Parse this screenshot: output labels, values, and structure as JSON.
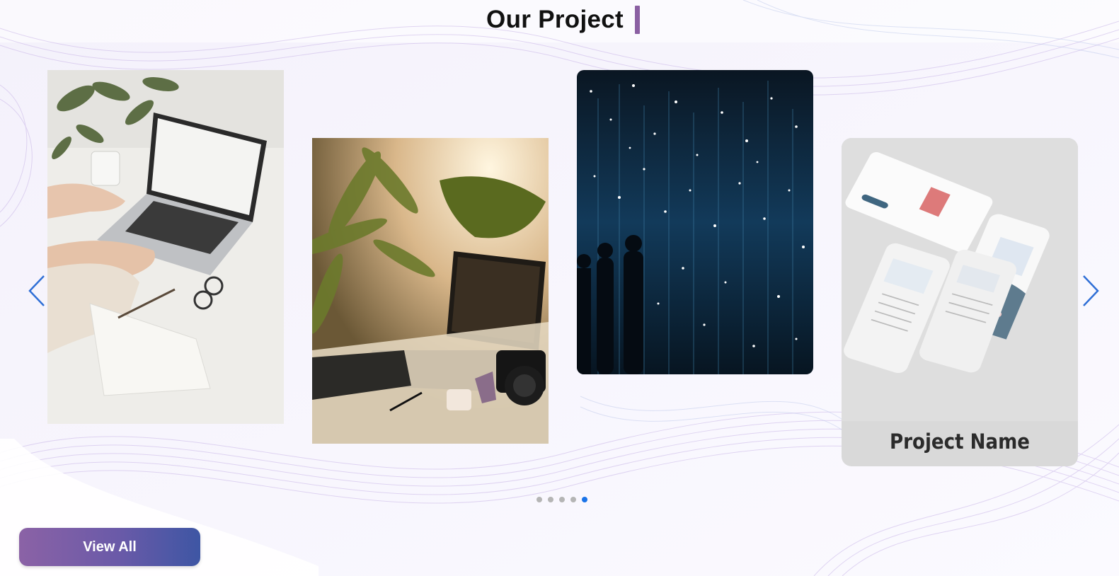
{
  "header": {
    "title": "Our Project",
    "accent_color": "#8a5fa2"
  },
  "carousel": {
    "cards": [
      {
        "id": "card1",
        "image": "laptop-desk-photo"
      },
      {
        "id": "card2",
        "image": "laptop-plants-photo"
      },
      {
        "id": "card3",
        "image": "light-installation-photo"
      },
      {
        "id": "card4",
        "image": "mobile-app-mockup",
        "project_name": "Project Name"
      }
    ],
    "prev_icon": "chevron-left-icon",
    "next_icon": "chevron-right-icon",
    "dots_total": 5,
    "active_dot": 5,
    "arrow_color": "#2f6fd6",
    "dot_active_color": "#1a73e8"
  },
  "actions": {
    "view_all_label": "View All"
  }
}
